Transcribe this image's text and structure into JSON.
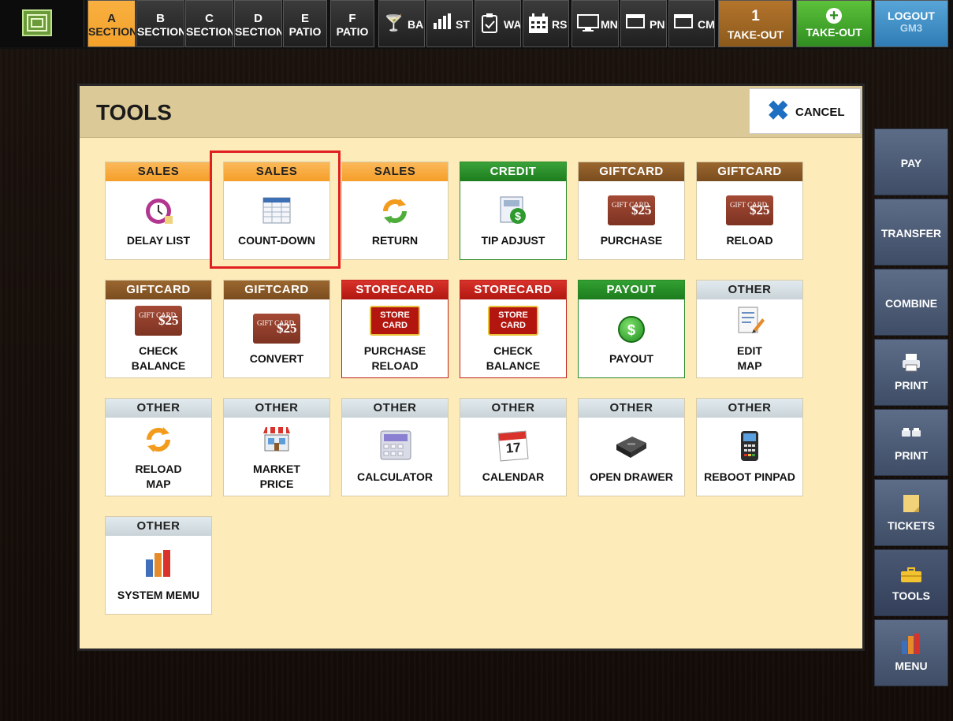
{
  "topbar": {
    "sections": [
      {
        "letter": "A",
        "label": "SECTION"
      },
      {
        "letter": "B",
        "label": "SECTION"
      },
      {
        "letter": "C",
        "label": "SECTION"
      },
      {
        "letter": "D",
        "label": "SECTION"
      },
      {
        "letter": "E",
        "label": "PATIO"
      },
      {
        "letter": "F",
        "label": "PATIO"
      }
    ],
    "selected_section": "A",
    "icon_buttons": [
      {
        "icon": "cocktail-icon",
        "label": "BA"
      },
      {
        "icon": "bar-chart-icon",
        "label": "ST"
      },
      {
        "icon": "clipboard-icon",
        "label": "WA"
      },
      {
        "icon": "calendar-icon",
        "label": "RS"
      },
      {
        "icon": "monitor-icon",
        "label": "MN"
      },
      {
        "icon": "window-icon",
        "label": "PN"
      },
      {
        "icon": "window-icon",
        "label": "CM"
      }
    ],
    "takeout_count": {
      "count": "1",
      "label": "TAKE-OUT"
    },
    "takeout_new": {
      "label": "TAKE-OUT"
    },
    "logout": {
      "label": "LOGOUT",
      "user": "GM3"
    }
  },
  "dialog": {
    "title": "TOOLS",
    "cancel_label": "CANCEL",
    "tiles": [
      {
        "category": "SALES",
        "label": "DELAY LIST",
        "icon": "clock-icon"
      },
      {
        "category": "SALES",
        "label": "COUNT-DOWN",
        "icon": "table-icon"
      },
      {
        "category": "SALES",
        "label": "RETURN",
        "icon": "recycle-arrows-icon"
      },
      {
        "category": "CREDIT",
        "label": "TIP ADJUST",
        "icon": "tip-dollar-icon"
      },
      {
        "category": "GIFTCARD",
        "label": "PURCHASE",
        "icon": "gift-card-icon"
      },
      {
        "category": "GIFTCARD",
        "label": "RELOAD",
        "icon": "gift-card-icon"
      },
      {
        "category": "GIFTCARD",
        "label": "CHECK BALANCE",
        "icon": "gift-card-icon"
      },
      {
        "category": "GIFTCARD",
        "label": "CONVERT",
        "icon": "gift-card-icon"
      },
      {
        "category": "STORECARD",
        "label": "PURCHASE RELOAD",
        "icon": "store-card-icon"
      },
      {
        "category": "STORECARD",
        "label": "CHECK BALANCE",
        "icon": "store-card-icon"
      },
      {
        "category": "PAYOUT",
        "label": "PAYOUT",
        "icon": "dollar-coin-icon"
      },
      {
        "category": "OTHER",
        "label": "EDIT MAP",
        "icon": "edit-doc-icon"
      },
      {
        "category": "OTHER",
        "label": "RELOAD MAP",
        "icon": "reload-arrows-icon"
      },
      {
        "category": "OTHER",
        "label": "MARKET PRICE",
        "icon": "market-stall-icon"
      },
      {
        "category": "OTHER",
        "label": "CALCULATOR",
        "icon": "calculator-icon"
      },
      {
        "category": "OTHER",
        "label": "CALENDAR",
        "icon": "calendar-17-icon"
      },
      {
        "category": "OTHER",
        "label": "OPEN DRAWER",
        "icon": "cash-drawer-icon"
      },
      {
        "category": "OTHER",
        "label": "REBOOT PINPAD",
        "icon": "pinpad-icon"
      },
      {
        "category": "OTHER",
        "label": "SYSTEM MEMU",
        "icon": "bar-chart-color-icon"
      }
    ],
    "gift_card_text": {
      "small": "GIFT CARD",
      "value": "$25"
    },
    "store_card_text": "STORE CARD",
    "calendar_day": "17",
    "coin_symbol": "$"
  },
  "sidebar": {
    "items": [
      {
        "label": "PAY"
      },
      {
        "label": "TRANSFER"
      },
      {
        "label": "COMBINE"
      },
      {
        "label": "PRINT",
        "icon": "printer-icon"
      },
      {
        "label": "PRINT",
        "icon": "double-printer-icon"
      },
      {
        "label": "TICKETS",
        "icon": "note-icon"
      },
      {
        "label": "TOOLS",
        "icon": "toolbox-icon"
      },
      {
        "label": "MENU",
        "icon": "bar-chart-color-icon"
      }
    ]
  },
  "colors": {
    "sales": "#f59e29",
    "credit": "#1d7d1d",
    "giftcard": "#7a4c1e",
    "storecard": "#b01710",
    "payout": "#1c7c1c",
    "other": "#d7dfe3",
    "selected_section": "#f3a12a",
    "highlight": "#e02020"
  }
}
